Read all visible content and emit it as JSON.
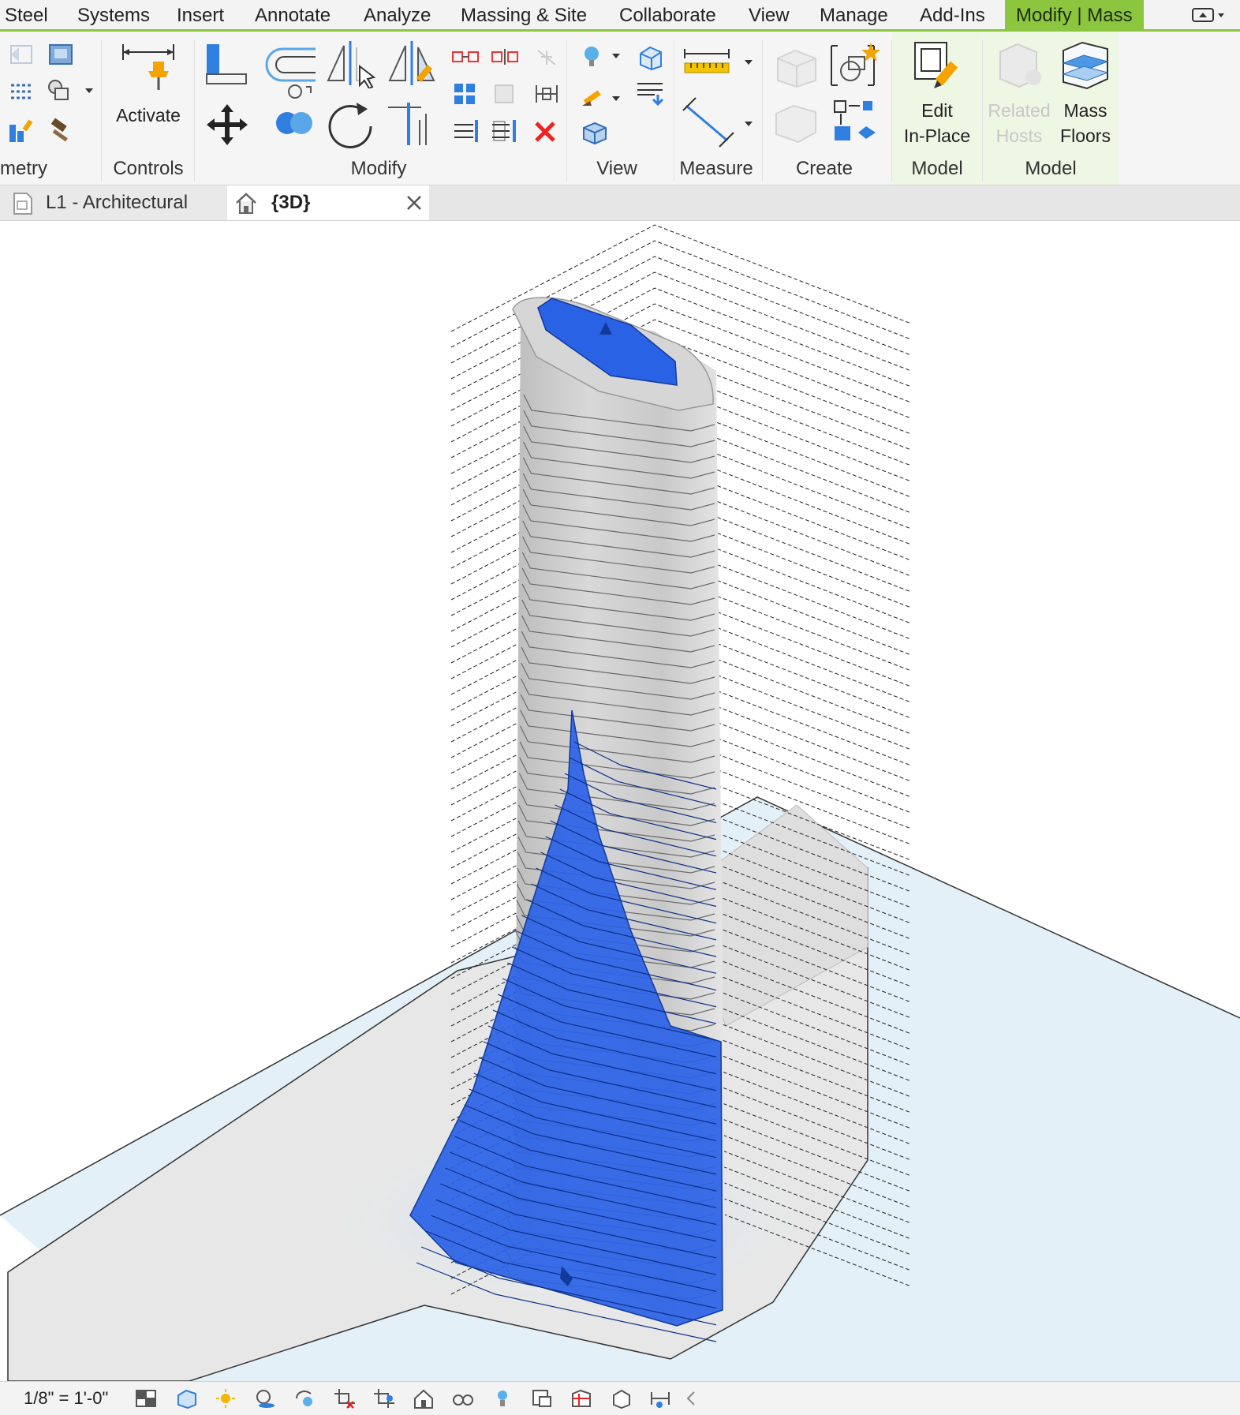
{
  "menu": {
    "tabs": [
      "Steel",
      "Systems",
      "Insert",
      "Annotate",
      "Analyze",
      "Massing & Site",
      "Collaborate",
      "View",
      "Manage",
      "Add-Ins"
    ],
    "active_tab": "Modify | Mass"
  },
  "ribbon": {
    "panels": {
      "geometry": "metry",
      "controls": "Controls",
      "modify": "Modify",
      "view": "View",
      "measure": "Measure",
      "create": "Create",
      "model_1": "Model",
      "model_2": "Model"
    },
    "buttons": {
      "activate": "Activate",
      "edit_in_place_1": "Edit",
      "edit_in_place_2": "In-Place",
      "related_hosts_1": "Related",
      "related_hosts_2": "Hosts",
      "mass_floors_1": "Mass",
      "mass_floors_2": "Floors"
    }
  },
  "document_tabs": [
    {
      "label": "L1 - Architectural",
      "active": false
    },
    {
      "label": "{3D}",
      "active": true
    }
  ],
  "status": {
    "scale": "1/8\" = 1'-0\""
  },
  "colors": {
    "accent": "#8cc63f",
    "selection": "#2a62e6",
    "mass_grey": "#cfcfcf",
    "ground": "#e4f0f8"
  }
}
